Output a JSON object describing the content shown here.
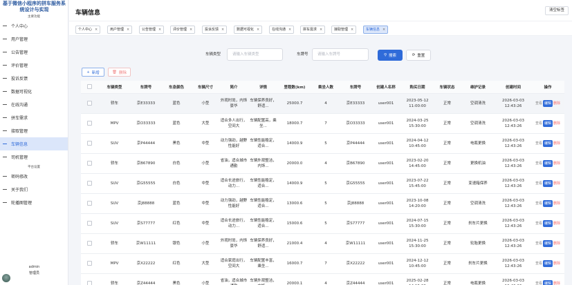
{
  "sidebar": {
    "system_title": "基于微信小程序的拼车服务系统设计与实现",
    "section_main": "主要功能",
    "section_platform": "平台设置",
    "main_items": [
      {
        "label": "个人中心"
      },
      {
        "label": "用户管理"
      },
      {
        "label": "公告管理"
      },
      {
        "label": "评价管理"
      },
      {
        "label": "投诉反馈"
      },
      {
        "label": "数据可视化"
      },
      {
        "label": "在线沟通"
      },
      {
        "label": "拼车需求"
      },
      {
        "label": "接取管理"
      },
      {
        "label": "车辆信息"
      },
      {
        "label": "司机管理"
      }
    ],
    "platform_items": [
      {
        "label": "密码修改"
      },
      {
        "label": "关于我们"
      },
      {
        "label": "轮播图管理"
      }
    ],
    "active_item": "车辆信息",
    "user": {
      "name": "admin",
      "role": "管理员"
    }
  },
  "header": {
    "title": "车辆信息",
    "clear_button": "清空标签"
  },
  "tabs": [
    {
      "label": "个人中心",
      "close": "×"
    },
    {
      "label": "用户管理",
      "close": "×"
    },
    {
      "label": "公告管理",
      "close": "×"
    },
    {
      "label": "评价管理",
      "close": "×"
    },
    {
      "label": "投诉反馈",
      "close": "×"
    },
    {
      "label": "数据可视化",
      "close": "×"
    },
    {
      "label": "在线沟通",
      "close": "×"
    },
    {
      "label": "拼车需求",
      "close": "×"
    },
    {
      "label": "接取管理",
      "close": "×"
    },
    {
      "label": "车辆信息",
      "close": "×"
    }
  ],
  "search": {
    "type_label": "车辆类型",
    "type_placeholder": "请输入车辆类型",
    "plate_label": "车牌号",
    "plate_placeholder": "请输入车牌号",
    "search_button": "搜索",
    "reset_button": "重置"
  },
  "toolbar": {
    "add_button": "新增",
    "delete_button": "删除"
  },
  "table": {
    "headers": [
      "车辆类型",
      "车牌号",
      "车身颜色",
      "车辆尺寸",
      "简介",
      "详情",
      "里程数(km)",
      "乘坐人数",
      "车牌号",
      "创建人名称",
      "购买日期",
      "车辆状态",
      "维护记录",
      "创建时间",
      "操作"
    ],
    "actions": {
      "view": "查看",
      "edit": "编辑",
      "delete": "删除"
    },
    "rows": [
      {
        "type": "轿车",
        "plate": "京E33333",
        "color": "蓝色",
        "size": "小型",
        "intro": "外观时尚，内饰豪华",
        "detail": "车辆保养良好，舒适...",
        "mileage": "25000.7",
        "seats": "4",
        "plate2": "京E33333",
        "creator": "user001",
        "buy_date": "2023-05-12 11:00:00",
        "status": "正常",
        "maint": "空调清洗",
        "created": "2026-03-03 12:43:26"
      },
      {
        "type": "MPV",
        "plate": "京O33333",
        "color": "蓝色",
        "size": "大型",
        "intro": "适合多人出行，空间大",
        "detail": "车辆配置高，乘坐...",
        "mileage": "18000.7",
        "seats": "7",
        "plate2": "京O33333",
        "creator": "user001",
        "buy_date": "2024-03-25 15:30:00",
        "status": "正常",
        "maint": "空调清洗",
        "created": "2026-03-03 12:43:26"
      },
      {
        "type": "SUV",
        "plate": "京P44444",
        "color": "黑色",
        "size": "中型",
        "intro": "动力强劲，越野性能好",
        "detail": "车辆性能稳定，适合...",
        "mileage": "14000.9",
        "seats": "5",
        "plate2": "京P44444",
        "creator": "user001",
        "buy_date": "2024-04-12 10:45:00",
        "status": "正常",
        "maint": "电瓶更换",
        "created": "2026-03-03 12:43:26"
      },
      {
        "type": "轿车",
        "plate": "京B67890",
        "color": "白色",
        "size": "小型",
        "intro": "省油，适合城市通勤",
        "detail": "车辆外观整洁，内饰...",
        "mileage": "20000.0",
        "seats": "4",
        "plate2": "京B67890",
        "creator": "user001",
        "buy_date": "2023-02-20 14:45:00",
        "status": "正常",
        "maint": "更换机油",
        "created": "2026-03-03 12:43:26"
      },
      {
        "type": "SUV",
        "plate": "京G55555",
        "color": "白色",
        "size": "中型",
        "intro": "适合长途旅行，动力...",
        "detail": "车辆性能稳定，适合...",
        "mileage": "14000.9",
        "seats": "5",
        "plate2": "京G55555",
        "creator": "user001",
        "buy_date": "2023-07-22 15:45:00",
        "status": "正常",
        "maint": "变速箱保养",
        "created": "2026-03-03 12:43:26"
      },
      {
        "type": "SUV",
        "plate": "京J88888",
        "color": "蓝色",
        "size": "中型",
        "intro": "动力强劲，越野性能好",
        "detail": "车辆性能稳定，适合...",
        "mileage": "13000.6",
        "seats": "5",
        "plate2": "京J88888",
        "creator": "user001",
        "buy_date": "2023-10-08 14:20:00",
        "status": "正常",
        "maint": "空调清洗",
        "created": "2026-03-03 12:43:26"
      },
      {
        "type": "SUV",
        "plate": "京S77777",
        "color": "红色",
        "size": "中型",
        "intro": "适合长途旅行，动力...",
        "detail": "车辆性能稳定，适合...",
        "mileage": "15000.6",
        "seats": "5",
        "plate2": "京S77777",
        "creator": "user001",
        "buy_date": "2024-07-15 15:30:00",
        "status": "正常",
        "maint": "刹车片更换",
        "created": "2026-03-03 12:43:26"
      },
      {
        "type": "轿车",
        "plate": "京W11111",
        "color": "银色",
        "size": "小型",
        "intro": "外观时尚，内饰豪华",
        "detail": "车辆保养良好，舒适...",
        "mileage": "21000.4",
        "seats": "4",
        "plate2": "京W11111",
        "creator": "user001",
        "buy_date": "2024-11-25 15:30:00",
        "status": "正常",
        "maint": "轮胎更换",
        "created": "2026-03-03 12:43:26"
      },
      {
        "type": "MPV",
        "plate": "京X22222",
        "color": "红色",
        "size": "大型",
        "intro": "适合家庭出行，空间大",
        "detail": "车辆配置丰富，乘坐...",
        "mileage": "16000.7",
        "seats": "7",
        "plate2": "京X22222",
        "creator": "user001",
        "buy_date": "2024-12-12 10:45:00",
        "status": "正常",
        "maint": "刹车片更换",
        "created": "2026-03-03 12:43:26"
      },
      {
        "type": "轿车",
        "plate": "京Z44444",
        "color": "黑色",
        "size": "小型",
        "intro": "省油，适合城市通勤",
        "detail": "车辆外观整洁，内饰...",
        "mileage": "20000.1",
        "seats": "4",
        "plate2": "京Z44444",
        "creator": "user001",
        "buy_date": "2025-02-28 14:15:00",
        "status": "正常",
        "maint": "电瓶更换",
        "created": "2026-03-03 12:43:26"
      }
    ]
  },
  "colors": {
    "accent": "#2f6bd9",
    "active_bg": "#dbe6fa",
    "danger": "#f56c6c"
  }
}
